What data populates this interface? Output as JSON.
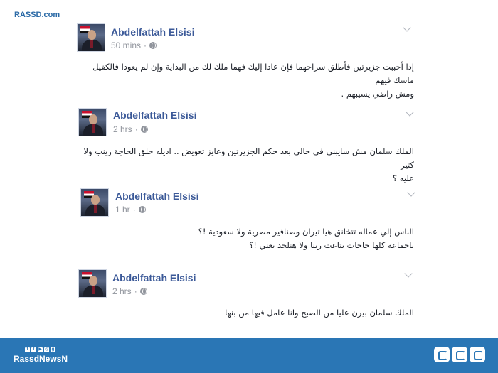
{
  "watermark": "RASSD.com",
  "posts": [
    {
      "author": "Abdelfattah Elsisi",
      "time": "50 mins",
      "separator": "·",
      "lines": [
        "إذا أحببت جزيرتين فأطلق سراحهما فإن عادا إليك فهما ملك لك من البداية وإن لم يعودا فالكفيل ماسك فيهم",
        "ومش راضي يسيبهم ."
      ]
    },
    {
      "author": "Abdelfattah Elsisi",
      "time": "2 hrs",
      "separator": "·",
      "lines": [
        "الملك سلمان مش سايبني في حالي بعد حكم الجزيرتين وعايز تعويض .. اديله حلق الحاجة زينب ولا كتير",
        "عليه ؟"
      ]
    },
    {
      "author": "Abdelfattah Elsisi",
      "time": "1 hr",
      "separator": "·",
      "lines": [
        "الناس إلي عماله تتخانق هيا تيران وصنافير مصرية ولا سعودية !؟",
        "ياجماعه كلها حاجات بتاعت ربنا ولا هنلحد بعني !؟"
      ]
    },
    {
      "author": "Abdelfattah Elsisi",
      "time": "2 hrs",
      "separator": "·",
      "lines": [
        "الملك سلمان بيرن عليا من الصبح وانا عامل فيها من بنها"
      ]
    }
  ],
  "footer": {
    "brand": "RassdNewsN",
    "social_icons": [
      "facebook-icon",
      "twitter-icon",
      "youtube-icon",
      "instagram-icon",
      "googleplus-icon"
    ],
    "social_glyphs": [
      "f",
      "t",
      "▶",
      "◎",
      "g"
    ],
    "accent_color": "#2a76b5"
  }
}
